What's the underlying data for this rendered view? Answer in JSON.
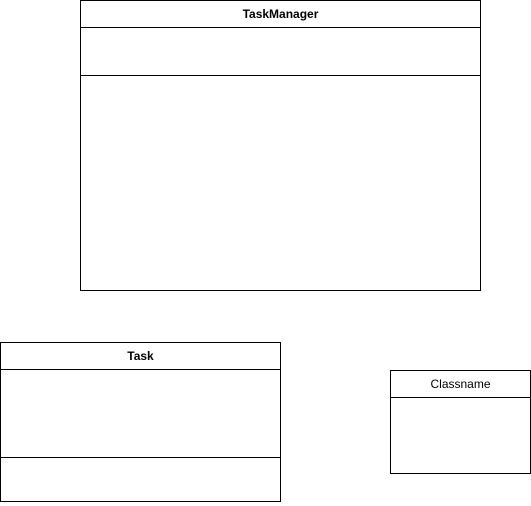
{
  "diagram": {
    "classes": [
      {
        "id": "taskmanager",
        "name": "TaskManager",
        "bold": true,
        "attributes": [],
        "operations": []
      },
      {
        "id": "task",
        "name": "Task",
        "bold": true,
        "attributes": [],
        "operations": []
      },
      {
        "id": "classname",
        "name": "Classname",
        "bold": false,
        "attributes": []
      }
    ]
  },
  "colors": {
    "border": "#000000",
    "background": "#ffffff",
    "text": "#000000"
  }
}
